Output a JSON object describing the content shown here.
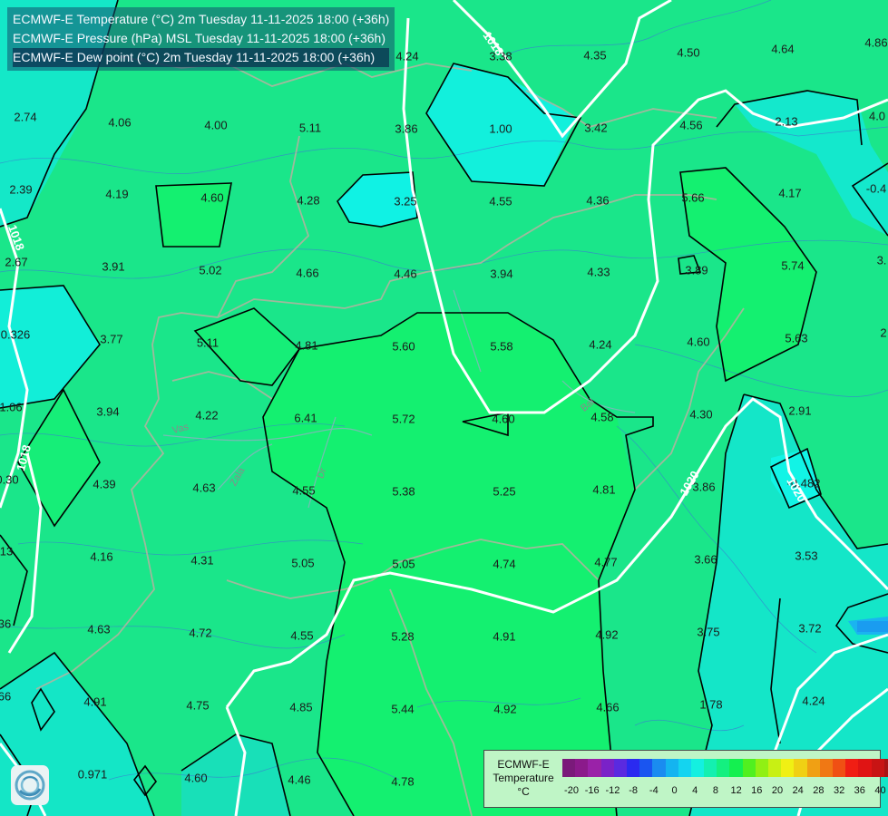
{
  "header": {
    "lines": [
      "ECMWF-E Temperature (°C) 2m Tuesday 11-11-2025 18:00 (+36h)",
      "ECMWF-E Pressure (hPa) MSL Tuesday 11-11-2025 18:00 (+36h)",
      "ECMWF-E Dew point (°C) 2m Tuesday 11-11-2025 18:00 (+36h)"
    ]
  },
  "map": {
    "background_color": "#1ae68a",
    "isobar_labels": [
      "1018",
      "1018",
      "1018",
      "1020",
      "1020"
    ],
    "river_labels": [
      "Vas",
      "Zala",
      "Bal",
      "Dr"
    ],
    "values": [
      {
        "v": "2.74"
      },
      {
        "v": "4.06"
      },
      {
        "v": "4.00"
      },
      {
        "v": "5.11"
      },
      {
        "v": "3.86"
      },
      {
        "v": "1.00"
      },
      {
        "v": "3.42"
      },
      {
        "v": "4.56"
      },
      {
        "v": "2.13"
      },
      {
        "v": "4.0"
      },
      {
        "v": "3.38"
      },
      {
        "v": "4.35"
      },
      {
        "v": "4.50"
      },
      {
        "v": "4.64"
      },
      {
        "v": "4.86"
      },
      {
        "v": "4.24"
      },
      {
        "v": "2.39"
      },
      {
        "v": "4.19"
      },
      {
        "v": "4.60"
      },
      {
        "v": "4.28"
      },
      {
        "v": "3.25"
      },
      {
        "v": "4.55"
      },
      {
        "v": "4.36"
      },
      {
        "v": "5.66"
      },
      {
        "v": "4.17"
      },
      {
        "v": "-0.4"
      },
      {
        "v": "2.67"
      },
      {
        "v": "3.91"
      },
      {
        "v": "5.02"
      },
      {
        "v": "4.66"
      },
      {
        "v": "4.46"
      },
      {
        "v": "3.94"
      },
      {
        "v": "4.33"
      },
      {
        "v": "3.89"
      },
      {
        "v": "5.74"
      },
      {
        "v": "3."
      },
      {
        "v": "0.326"
      },
      {
        "v": "3.77"
      },
      {
        "v": "5.11"
      },
      {
        "v": "4.81"
      },
      {
        "v": "5.60"
      },
      {
        "v": "5.58"
      },
      {
        "v": "4.24"
      },
      {
        "v": "4.60"
      },
      {
        "v": "5.63"
      },
      {
        "v": "2"
      },
      {
        "v": "1.06"
      },
      {
        "v": "3.94"
      },
      {
        "v": "4.22"
      },
      {
        "v": "6.41"
      },
      {
        "v": "5.72"
      },
      {
        "v": "4.60"
      },
      {
        "v": "4.58"
      },
      {
        "v": "4.30"
      },
      {
        "v": "2.91"
      },
      {
        "v": "0.30"
      },
      {
        "v": "4.39"
      },
      {
        "v": "4.63"
      },
      {
        "v": "4.55"
      },
      {
        "v": "5.38"
      },
      {
        "v": "5.25"
      },
      {
        "v": "4.81"
      },
      {
        "v": "3.86"
      },
      {
        "v": "-0.482"
      },
      {
        "v": "13"
      },
      {
        "v": "4.16"
      },
      {
        "v": "4.31"
      },
      {
        "v": "5.05"
      },
      {
        "v": "5.05"
      },
      {
        "v": "4.74"
      },
      {
        "v": "4.77"
      },
      {
        "v": "3.66"
      },
      {
        "v": "3.53"
      },
      {
        "v": "36"
      },
      {
        "v": "4.63"
      },
      {
        "v": "4.72"
      },
      {
        "v": "4.55"
      },
      {
        "v": "5.28"
      },
      {
        "v": "4.91"
      },
      {
        "v": "4.92"
      },
      {
        "v": "3.75"
      },
      {
        "v": "3.72"
      },
      {
        "v": "66"
      },
      {
        "v": "4.91"
      },
      {
        "v": "4.75"
      },
      {
        "v": "4.85"
      },
      {
        "v": "5.44"
      },
      {
        "v": "4.92"
      },
      {
        "v": "4.66"
      },
      {
        "v": "1.78"
      },
      {
        "v": "4.24"
      },
      {
        "v": "0.971"
      },
      {
        "v": "4.60"
      },
      {
        "v": "4.46"
      },
      {
        "v": "4.78"
      }
    ]
  },
  "legend": {
    "title_lines": [
      "ECMWF-E",
      "Temperature",
      "°C"
    ],
    "ticks": [
      "-20",
      "-16",
      "-12",
      "-8",
      "-4",
      "0",
      "4",
      "8",
      "12",
      "16",
      "20",
      "24",
      "28",
      "32",
      "36",
      "40"
    ],
    "colors": [
      "#7a1a7a",
      "#8b1a8b",
      "#9a22a8",
      "#7a22c8",
      "#5a2ae0",
      "#2a2af0",
      "#1a55f0",
      "#1a8cf0",
      "#14b4f0",
      "#14d4f0",
      "#14f0e0",
      "#14f0b0",
      "#14f080",
      "#14f050",
      "#50f020",
      "#90f014",
      "#c8f014",
      "#f0f014",
      "#f0d014",
      "#f0a014",
      "#f07814",
      "#f05014",
      "#f01e14",
      "#e01414",
      "#c81414",
      "#a81414",
      "#8c1414",
      "#701414"
    ]
  }
}
